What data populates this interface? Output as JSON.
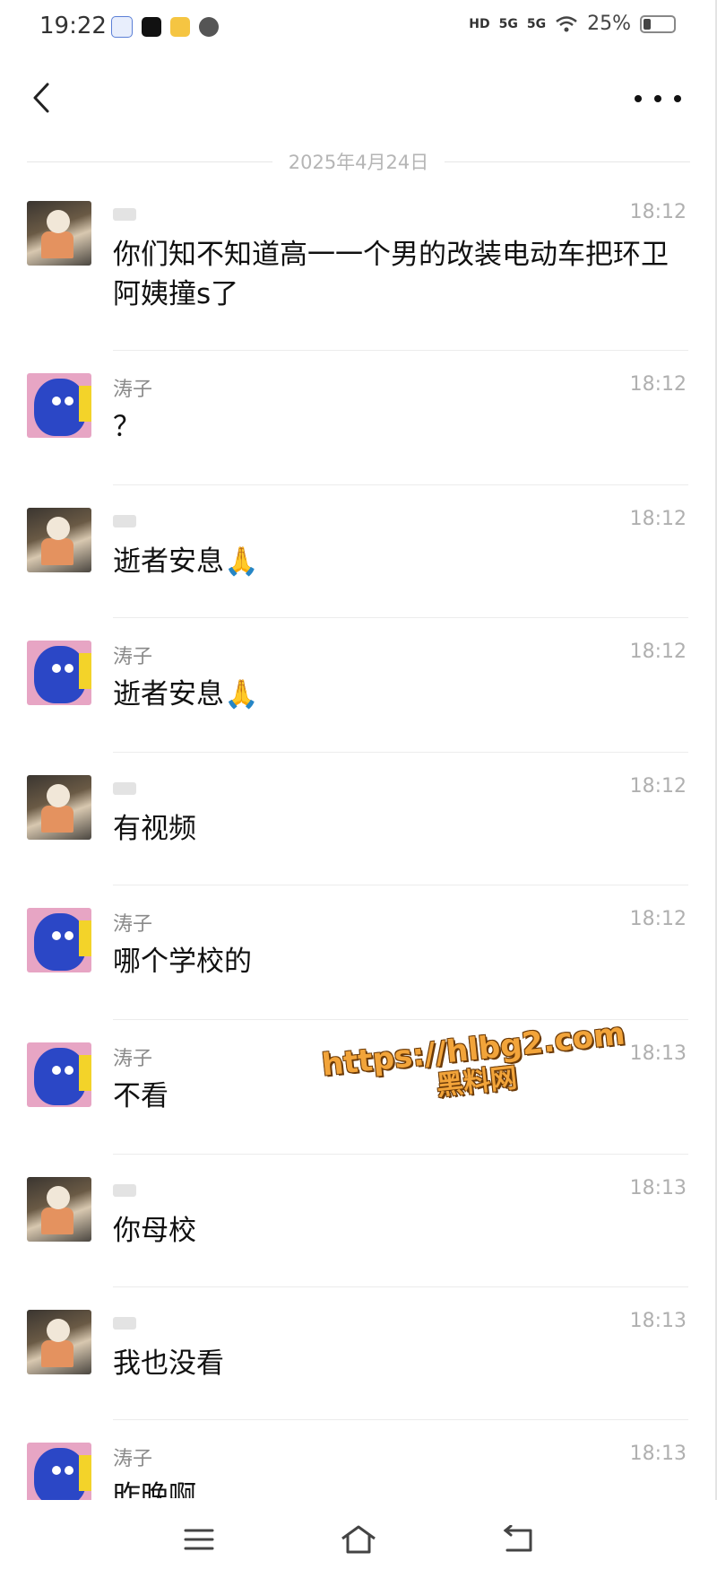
{
  "status_bar": {
    "time": "19:22",
    "battery": "25%",
    "battery_level": 0.25,
    "network_1": "5G",
    "network_2": "5G",
    "hd_label": "HD"
  },
  "header": {
    "back_icon": "chevron-left-icon",
    "more_icon": "more-horizontal-icon"
  },
  "chat": {
    "date_separator": "2025年4月24日",
    "messages": [
      {
        "sender": "",
        "avatar": "girl",
        "time": "18:12",
        "text": "你们知不知道高一一个男的改装电动车把环卫阿姨撞s了"
      },
      {
        "sender": "涛子",
        "avatar": "blue",
        "time": "18:12",
        "text": "？"
      },
      {
        "sender": "",
        "avatar": "girl",
        "time": "18:12",
        "text": "逝者安息🙏"
      },
      {
        "sender": "涛子",
        "avatar": "blue",
        "time": "18:12",
        "text": "逝者安息🙏"
      },
      {
        "sender": "",
        "avatar": "girl",
        "time": "18:12",
        "text": "有视频"
      },
      {
        "sender": "涛子",
        "avatar": "blue",
        "time": "18:12",
        "text": "哪个学校的"
      },
      {
        "sender": "涛子",
        "avatar": "blue",
        "time": "18:13",
        "text": "不看"
      },
      {
        "sender": "",
        "avatar": "girl",
        "time": "18:13",
        "text": "你母校"
      },
      {
        "sender": "",
        "avatar": "girl",
        "time": "18:13",
        "text": "我也没看"
      },
      {
        "sender": "涛子",
        "avatar": "blue",
        "time": "18:13",
        "text": "昨晚啊"
      }
    ]
  },
  "watermark": {
    "url": "https://hlbg2.com",
    "sub": "黑料网"
  },
  "nav_bar": {
    "menu_icon": "menu-icon",
    "home_icon": "home-icon",
    "back_icon": "return-icon"
  }
}
